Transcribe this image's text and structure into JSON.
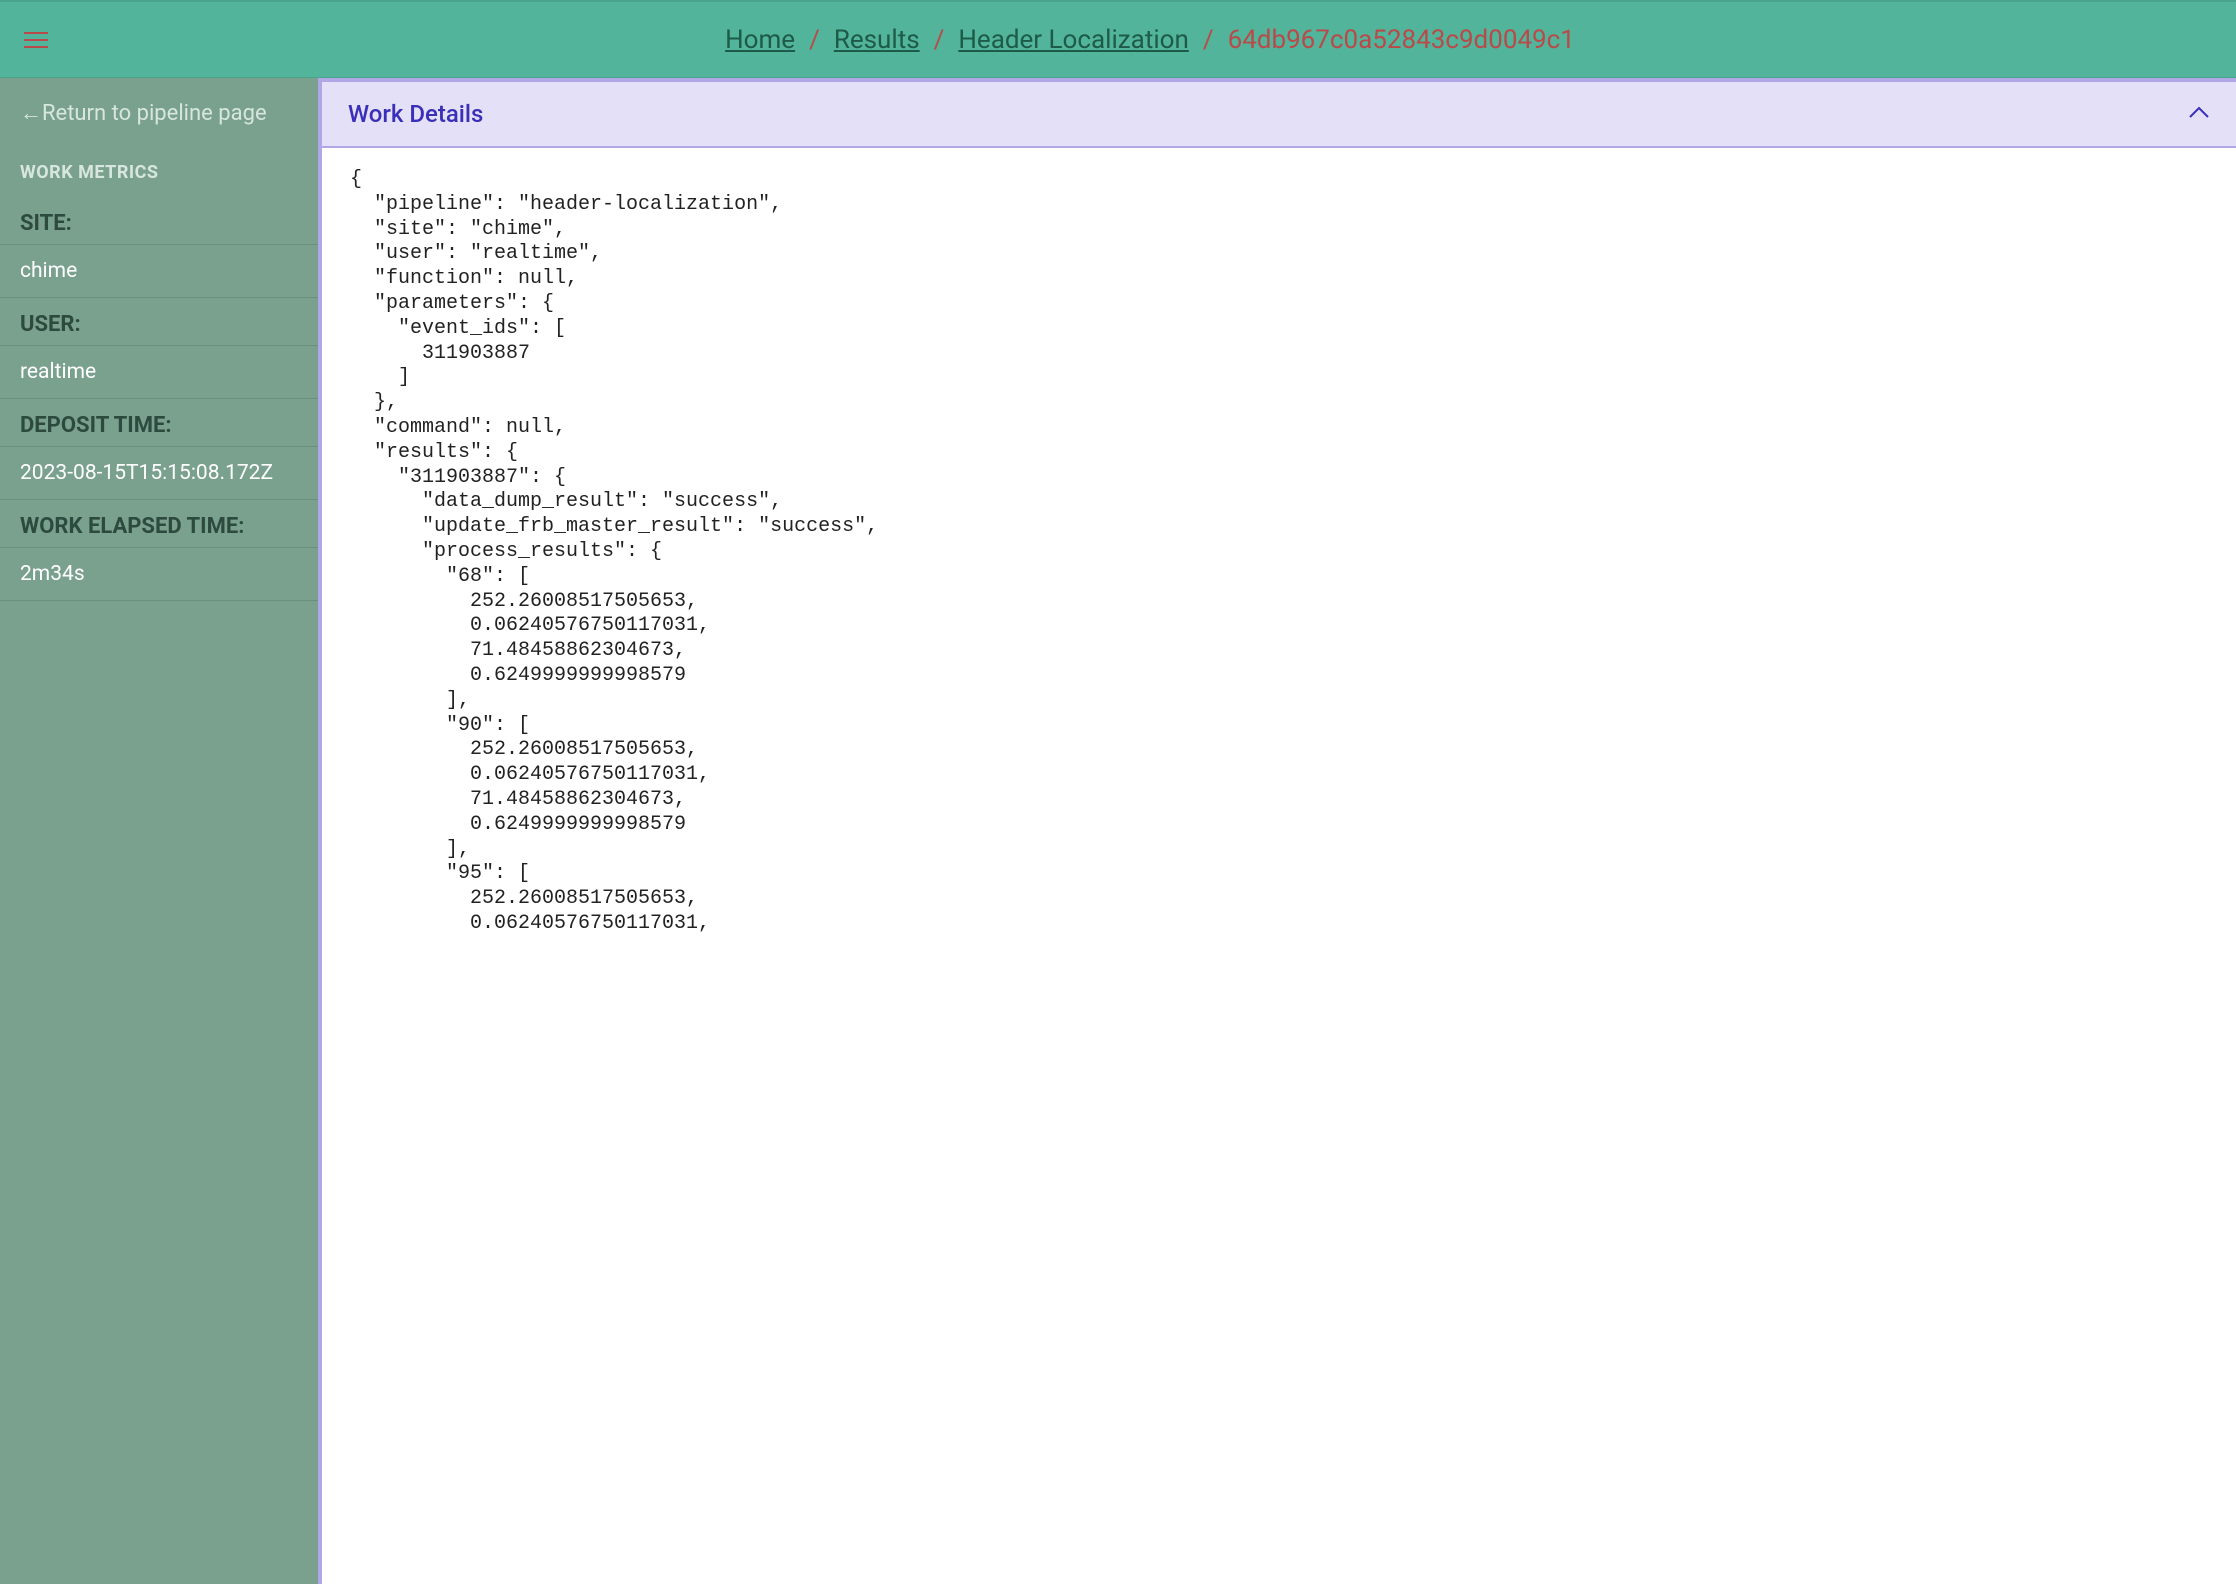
{
  "header": {
    "breadcrumbs": [
      {
        "label": "Home"
      },
      {
        "label": "Results"
      },
      {
        "label": "Header Localization"
      }
    ],
    "current": "64db967c0a52843c9d0049c1"
  },
  "sidebar": {
    "return_label": "←Return to pipeline page",
    "section_heading": "WORK METRICS",
    "metrics": [
      {
        "label": "SITE:",
        "value": "chime"
      },
      {
        "label": "USER:",
        "value": "realtime"
      },
      {
        "label": "DEPOSIT TIME:",
        "value": "2023-08-15T15:15:08.172Z"
      },
      {
        "label": "WORK ELAPSED TIME:",
        "value": "2m34s"
      }
    ]
  },
  "panel": {
    "title": "Work Details"
  },
  "work_details": {
    "pipeline": "header-localization",
    "site": "chime",
    "user": "realtime",
    "function": null,
    "parameters": {
      "event_ids": [
        311903887
      ]
    },
    "command": null,
    "results": {
      "311903887": {
        "data_dump_result": "success",
        "update_frb_master_result": "success",
        "process_results": {
          "68": [
            252.26008517505653,
            0.06240576750117031,
            71.48458862304673,
            0.6249999999998579
          ],
          "90": [
            252.26008517505653,
            0.06240576750117031,
            71.48458862304673,
            0.6249999999998579
          ],
          "95": [
            252.26008517505653,
            0.06240576750117031
          ]
        }
      }
    }
  },
  "code_text": "{\n  \"pipeline\": \"header-localization\",\n  \"site\": \"chime\",\n  \"user\": \"realtime\",\n  \"function\": null,\n  \"parameters\": {\n    \"event_ids\": [\n      311903887\n    ]\n  },\n  \"command\": null,\n  \"results\": {\n    \"311903887\": {\n      \"data_dump_result\": \"success\",\n      \"update_frb_master_result\": \"success\",\n      \"process_results\": {\n        \"68\": [\n          252.26008517505653,\n          0.06240576750117031,\n          71.48458862304673,\n          0.6249999999998579\n        ],\n        \"90\": [\n          252.26008517505653,\n          0.06240576750117031,\n          71.48458862304673,\n          0.6249999999998579\n        ],\n        \"95\": [\n          252.26008517505653,\n          0.06240576750117031,"
}
